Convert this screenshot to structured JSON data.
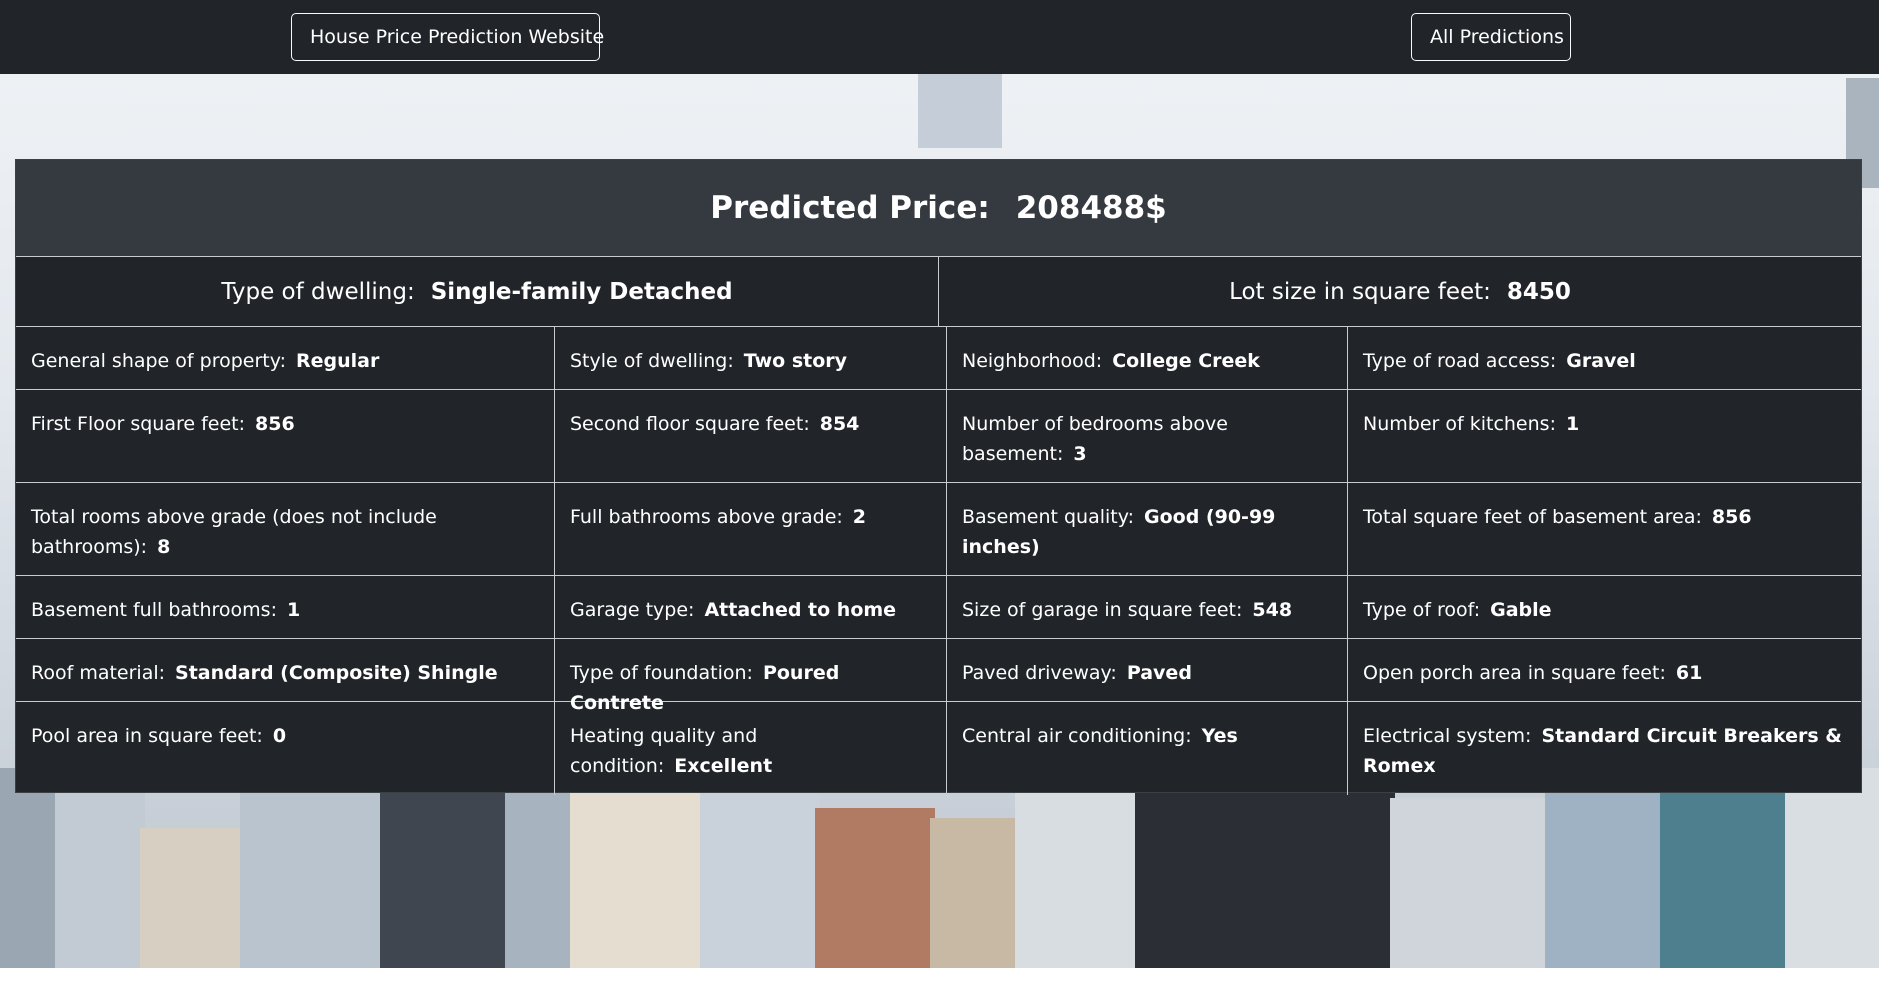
{
  "nav": {
    "brand": "House Price Prediction Website",
    "all_predictions": "All Predictions"
  },
  "result": {
    "price_label": "Predicted Price:",
    "price_value": "208488$"
  },
  "summary": [
    {
      "label": "Type of dwelling:",
      "value": "Single-family Detached"
    },
    {
      "label": "Lot size in square feet:",
      "value": "8450"
    }
  ],
  "features": [
    [
      {
        "label": "General shape of property:",
        "value": "Regular"
      },
      {
        "label": "Style of dwelling:",
        "value": "Two story"
      },
      {
        "label": "Neighborhood:",
        "value": "College Creek"
      },
      {
        "label": "Type of road access:",
        "value": "Gravel"
      }
    ],
    [
      {
        "label": "First Floor square feet:",
        "value": "856"
      },
      {
        "label": "Second floor square feet:",
        "value": "854"
      },
      {
        "label": "Number of bedrooms above basement:",
        "value": "3"
      },
      {
        "label": "Number of kitchens:",
        "value": "1"
      }
    ],
    [
      {
        "label": "Total rooms above grade (does not include bathrooms):",
        "value": "8"
      },
      {
        "label": "Full bathrooms above grade:",
        "value": "2"
      },
      {
        "label": "Basement quality:",
        "value": "Good (90-99 inches)"
      },
      {
        "label": "Total square feet of basement area:",
        "value": "856"
      }
    ],
    [
      {
        "label": "Basement full bathrooms:",
        "value": "1"
      },
      {
        "label": "Garage type:",
        "value": "Attached to home"
      },
      {
        "label": "Size of garage in square feet:",
        "value": "548"
      },
      {
        "label": "Type of roof:",
        "value": "Gable"
      }
    ],
    [
      {
        "label": "Roof material:",
        "value": "Standard (Composite) Shingle"
      },
      {
        "label": "Type of foundation:",
        "value": "Poured Contrete"
      },
      {
        "label": "Paved driveway:",
        "value": "Paved"
      },
      {
        "label": "Open porch area in square feet:",
        "value": "61"
      }
    ],
    [
      {
        "label": "Pool area in square feet:",
        "value": "0"
      },
      {
        "label": "Heating quality and condition:",
        "value": "Excellent"
      },
      {
        "label": "Central air conditioning:",
        "value": "Yes"
      },
      {
        "label": "Electrical system:",
        "value": "Standard Circuit Breakers & Romex"
      }
    ]
  ],
  "colors": {
    "navbar": "#212529",
    "card": "#212529",
    "header": "#343a40",
    "text": "#ffffff"
  }
}
